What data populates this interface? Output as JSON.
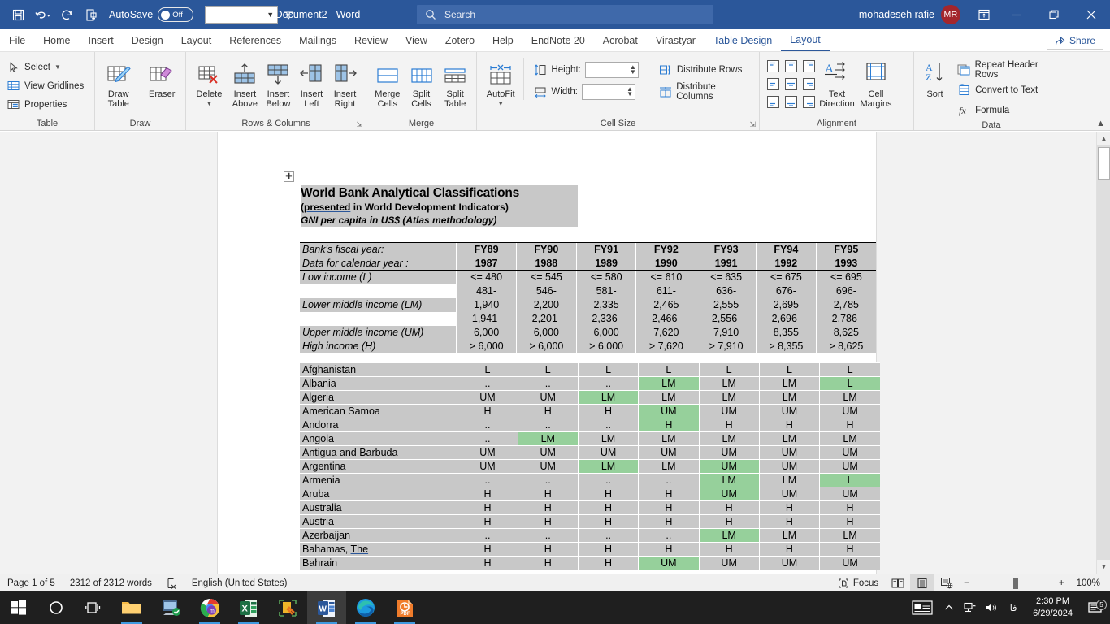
{
  "titlebar": {
    "quick_access": [
      {
        "name": "save-icon",
        "label": "Save"
      },
      {
        "name": "undo-icon",
        "label": "Undo"
      },
      {
        "name": "redo-icon",
        "label": "Redo"
      },
      {
        "name": "print-preview-icon",
        "label": "Print Preview and Print"
      }
    ],
    "autosave_label": "AutoSave",
    "autosave_state": "Off",
    "combo_value": "",
    "document_title": "Document2  -  Word",
    "search_placeholder": "Search",
    "user_name": "mohadeseh rafie",
    "avatar_initials": "MR",
    "window_buttons": {
      "ribbon_display": "ribbon-display-options",
      "minimize": "Minimize",
      "restore": "Restore Down",
      "close": "Close"
    }
  },
  "tabs": [
    {
      "label": "File",
      "state": "normal"
    },
    {
      "label": "Home",
      "state": "normal"
    },
    {
      "label": "Insert",
      "state": "normal"
    },
    {
      "label": "Design",
      "state": "normal"
    },
    {
      "label": "Layout",
      "state": "normal"
    },
    {
      "label": "References",
      "state": "normal"
    },
    {
      "label": "Mailings",
      "state": "normal"
    },
    {
      "label": "Review",
      "state": "normal"
    },
    {
      "label": "View",
      "state": "normal"
    },
    {
      "label": "Zotero",
      "state": "normal"
    },
    {
      "label": "Help",
      "state": "normal"
    },
    {
      "label": "EndNote 20",
      "state": "normal"
    },
    {
      "label": "Acrobat",
      "state": "normal"
    },
    {
      "label": "Virastyar",
      "state": "normal"
    },
    {
      "label": "Table Design",
      "state": "contextual"
    },
    {
      "label": "Layout",
      "state": "active"
    }
  ],
  "share_button": "Share",
  "ribbon": {
    "groups": [
      {
        "name": "table",
        "label": "Table",
        "items": [
          {
            "label": "Select",
            "icon": "cursor-select-icon",
            "has_chevron": true
          },
          {
            "label": "View Gridlines",
            "icon": "gridlines-icon"
          },
          {
            "label": "Properties",
            "icon": "table-properties-icon"
          }
        ]
      },
      {
        "name": "draw",
        "label": "Draw",
        "items": [
          {
            "label": "Draw Table",
            "icon": "draw-table-icon"
          },
          {
            "label": "Eraser",
            "icon": "eraser-icon"
          }
        ]
      },
      {
        "name": "rows-columns",
        "label": "Rows & Columns",
        "has_launcher": true,
        "items": [
          {
            "label": "Delete",
            "icon": "delete-table-icon",
            "has_chevron": true
          },
          {
            "label": "Insert Above",
            "icon": "insert-above-icon"
          },
          {
            "label": "Insert Below",
            "icon": "insert-below-icon"
          },
          {
            "label": "Insert Left",
            "icon": "insert-left-icon"
          },
          {
            "label": "Insert Right",
            "icon": "insert-right-icon"
          }
        ]
      },
      {
        "name": "merge",
        "label": "Merge",
        "items": [
          {
            "label": "Merge Cells",
            "icon": "merge-cells-icon"
          },
          {
            "label": "Split Cells",
            "icon": "split-cells-icon"
          },
          {
            "label": "Split Table",
            "icon": "split-table-icon"
          }
        ]
      },
      {
        "name": "cell-size",
        "label": "Cell Size",
        "has_launcher": true,
        "items": [
          {
            "label": "AutoFit",
            "icon": "autofit-icon",
            "has_chevron": true
          },
          {
            "label": "Height:",
            "icon": "row-height-icon",
            "value": ""
          },
          {
            "label": "Width:",
            "icon": "column-width-icon",
            "value": ""
          },
          {
            "label": "Distribute Rows",
            "icon": "distribute-rows-icon"
          },
          {
            "label": "Distribute Columns",
            "icon": "distribute-columns-icon"
          }
        ]
      },
      {
        "name": "alignment",
        "label": "Alignment",
        "items": [
          {
            "label": "Align Top Left",
            "icon": "align-top-left-icon"
          },
          {
            "label": "Align Top Center",
            "icon": "align-top-center-icon"
          },
          {
            "label": "Align Top Right",
            "icon": "align-top-right-icon"
          },
          {
            "label": "Align Center Left",
            "icon": "align-center-left-icon"
          },
          {
            "label": "Align Center",
            "icon": "align-center-icon"
          },
          {
            "label": "Align Center Right",
            "icon": "align-center-right-icon"
          },
          {
            "label": "Align Bottom Left",
            "icon": "align-bottom-left-icon"
          },
          {
            "label": "Align Bottom Center",
            "icon": "align-bottom-center-icon"
          },
          {
            "label": "Align Bottom Right",
            "icon": "align-bottom-right-icon"
          },
          {
            "label": "Text Direction",
            "icon": "text-direction-icon"
          },
          {
            "label": "Cell Margins",
            "icon": "cell-margins-icon"
          }
        ]
      },
      {
        "name": "data",
        "label": "Data",
        "items": [
          {
            "label": "Sort",
            "icon": "sort-az-icon"
          },
          {
            "label": "Repeat Header Rows",
            "icon": "repeat-header-rows-icon"
          },
          {
            "label": "Convert to Text",
            "icon": "convert-to-text-icon"
          },
          {
            "label": "Formula",
            "icon": "formula-fx-icon"
          }
        ]
      }
    ],
    "collapse_label": "Collapse the Ribbon"
  },
  "document": {
    "title_block": {
      "line1": "World Bank Analytical Classifications",
      "line2_prefix": "(",
      "line2_link": "presented",
      "line2_suffix": " in World Development Indicators)",
      "line3": "GNI per capita in US$ (Atlas methodology)"
    },
    "classification_table": {
      "header_rows": [
        {
          "label": "Bank's fiscal year:",
          "values": [
            "FY89",
            "FY90",
            "FY91",
            "FY92",
            "FY93",
            "FY94",
            "FY95"
          ]
        },
        {
          "label": "Data for calendar year :",
          "values": [
            "1987",
            "1988",
            "1989",
            "1990",
            "1991",
            "1992",
            "1993"
          ]
        }
      ],
      "body_rows": [
        {
          "label": "Low income (L)",
          "label_bg": "grey",
          "values": [
            "<= 480",
            "<= 545",
            "<= 580",
            "<= 610",
            "<= 635",
            "<= 675",
            "<= 695"
          ]
        },
        {
          "label": "",
          "label_bg": "white",
          "values": [
            "481-",
            "546-",
            "581-",
            "611-",
            "636-",
            "676-",
            "696-"
          ]
        },
        {
          "label": "Lower middle income (LM)",
          "label_bg": "grey",
          "values": [
            "1,940",
            "2,200",
            "2,335",
            "2,465",
            "2,555",
            "2,695",
            "2,785"
          ]
        },
        {
          "label": "",
          "label_bg": "white",
          "values": [
            "1,941-",
            "2,201-",
            "2,336-",
            "2,466-",
            "2,556-",
            "2,696-",
            "2,786-"
          ]
        },
        {
          "label": "Upper middle income (UM)",
          "label_bg": "grey",
          "values": [
            "6,000",
            "6,000",
            "6,000",
            "7,620",
            "7,910",
            "8,355",
            "8,625"
          ]
        },
        {
          "label": "High income (H)",
          "label_bg": "grey",
          "values": [
            "> 6,000",
            "> 6,000",
            "> 6,000",
            "> 7,620",
            "> 7,910",
            "> 8,355",
            "> 8,625"
          ]
        }
      ]
    },
    "country_table": {
      "rows": [
        {
          "country": "Afghanistan",
          "values": [
            "L",
            "L",
            "L",
            "L",
            "L",
            "L",
            "L"
          ],
          "highlight": [
            false,
            false,
            false,
            false,
            false,
            false,
            false
          ]
        },
        {
          "country": "Albania",
          "values": [
            "..",
            "..",
            "..",
            "LM",
            "LM",
            "LM",
            "L"
          ],
          "highlight": [
            false,
            false,
            false,
            true,
            false,
            false,
            true
          ]
        },
        {
          "country": "Algeria",
          "values": [
            "UM",
            "UM",
            "LM",
            "LM",
            "LM",
            "LM",
            "LM"
          ],
          "highlight": [
            false,
            false,
            true,
            false,
            false,
            false,
            false
          ]
        },
        {
          "country": "American Samoa",
          "values": [
            "H",
            "H",
            "H",
            "UM",
            "UM",
            "UM",
            "UM"
          ],
          "highlight": [
            false,
            false,
            false,
            true,
            false,
            false,
            false
          ]
        },
        {
          "country": "Andorra",
          "values": [
            "..",
            "..",
            "..",
            "H",
            "H",
            "H",
            "H"
          ],
          "highlight": [
            false,
            false,
            false,
            true,
            false,
            false,
            false
          ]
        },
        {
          "country": "Angola",
          "values": [
            "..",
            "LM",
            "LM",
            "LM",
            "LM",
            "LM",
            "LM"
          ],
          "highlight": [
            false,
            true,
            false,
            false,
            false,
            false,
            false
          ]
        },
        {
          "country": "Antigua and Barbuda",
          "values": [
            "UM",
            "UM",
            "UM",
            "UM",
            "UM",
            "UM",
            "UM"
          ],
          "highlight": [
            false,
            false,
            false,
            false,
            false,
            false,
            false
          ]
        },
        {
          "country": "Argentina",
          "values": [
            "UM",
            "UM",
            "LM",
            "LM",
            "UM",
            "UM",
            "UM"
          ],
          "highlight": [
            false,
            false,
            true,
            false,
            true,
            false,
            false
          ]
        },
        {
          "country": "Armenia",
          "values": [
            "..",
            "..",
            "..",
            "..",
            "LM",
            "LM",
            "L"
          ],
          "highlight": [
            false,
            false,
            false,
            false,
            true,
            false,
            true
          ]
        },
        {
          "country": "Aruba",
          "values": [
            "H",
            "H",
            "H",
            "H",
            "UM",
            "UM",
            "UM"
          ],
          "highlight": [
            false,
            false,
            false,
            false,
            true,
            false,
            false
          ]
        },
        {
          "country": "Australia",
          "values": [
            "H",
            "H",
            "H",
            "H",
            "H",
            "H",
            "H"
          ],
          "highlight": [
            false,
            false,
            false,
            false,
            false,
            false,
            false
          ]
        },
        {
          "country": "Austria",
          "values": [
            "H",
            "H",
            "H",
            "H",
            "H",
            "H",
            "H"
          ],
          "highlight": [
            false,
            false,
            false,
            false,
            false,
            false,
            false
          ]
        },
        {
          "country": "Azerbaijan",
          "values": [
            "..",
            "..",
            "..",
            "..",
            "LM",
            "LM",
            "LM"
          ],
          "highlight": [
            false,
            false,
            false,
            false,
            true,
            false,
            false
          ]
        },
        {
          "country": "Bahamas, The",
          "country_link": "The",
          "values": [
            "H",
            "H",
            "H",
            "H",
            "H",
            "H",
            "H"
          ],
          "highlight": [
            false,
            false,
            false,
            false,
            false,
            false,
            false
          ]
        },
        {
          "country": "Bahrain",
          "values": [
            "H",
            "H",
            "H",
            "UM",
            "UM",
            "UM",
            "UM"
          ],
          "highlight": [
            false,
            false,
            false,
            true,
            false,
            false,
            false
          ]
        }
      ],
      "highlight_color": "#96d09b",
      "cell_bg": "#c8c8c8"
    }
  },
  "statusbar": {
    "page": "Page 1 of 5",
    "words": "2312 of 2312 words",
    "proofing_icon": "proofing-errors-icon",
    "language": "English (United States)",
    "focus": "Focus",
    "views": [
      {
        "name": "read-mode-icon",
        "active": false
      },
      {
        "name": "print-layout-icon",
        "active": true
      },
      {
        "name": "web-layout-icon",
        "active": false
      }
    ],
    "zoom_out": "−",
    "zoom_in": "+",
    "zoom_level": "100%"
  },
  "taskbar": {
    "items": [
      {
        "name": "start-button",
        "label": "Start"
      },
      {
        "name": "cortana-search-icon",
        "label": "Search"
      },
      {
        "name": "task-view-icon",
        "label": "Task View"
      },
      {
        "name": "file-explorer-icon",
        "label": "File Explorer",
        "running": true
      },
      {
        "name": "remote-desktop-icon",
        "label": "Remote Desktop"
      },
      {
        "name": "chrome-icon",
        "label": "Google Chrome",
        "running": true
      },
      {
        "name": "excel-icon",
        "label": "Excel",
        "running": true
      },
      {
        "name": "app-builder-icon",
        "label": "Application"
      },
      {
        "name": "word-icon",
        "label": "Word",
        "running": true,
        "active": true
      },
      {
        "name": "edge-icon",
        "label": "Microsoft Edge",
        "running": true
      },
      {
        "name": "pdf-icon",
        "label": "PDF Reader",
        "running": true
      }
    ],
    "tray": {
      "news_icon": "news-and-interests-icon",
      "chevron": "show-hidden-icons",
      "network_icon": "network-icon",
      "volume_icon": "volume-icon",
      "language": "فا",
      "time": "2:30 PM",
      "date": "6/29/2024",
      "notifications_icon": "notifications-icon",
      "notifications_count": "5"
    }
  }
}
